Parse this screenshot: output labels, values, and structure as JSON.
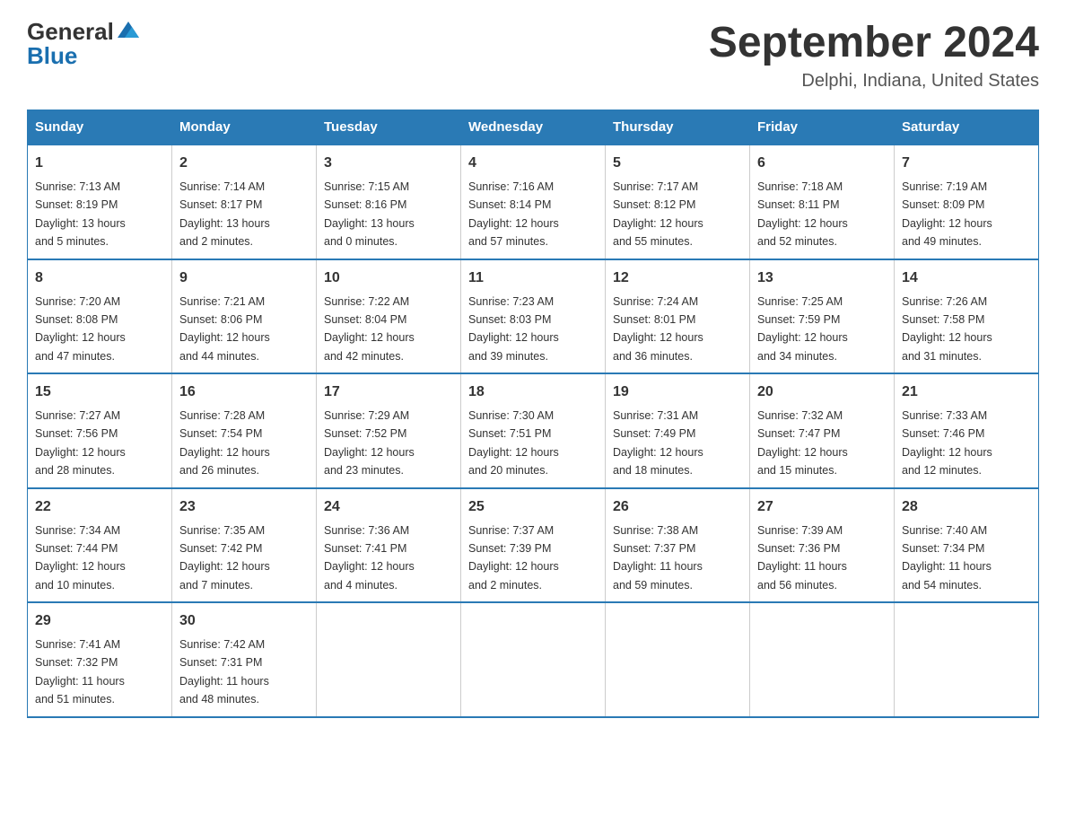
{
  "header": {
    "logo_general": "General",
    "logo_blue": "Blue",
    "title": "September 2024",
    "subtitle": "Delphi, Indiana, United States"
  },
  "weekdays": [
    "Sunday",
    "Monday",
    "Tuesday",
    "Wednesday",
    "Thursday",
    "Friday",
    "Saturday"
  ],
  "weeks": [
    [
      {
        "day": "1",
        "sunrise": "7:13 AM",
        "sunset": "8:19 PM",
        "daylight": "13 hours and 5 minutes."
      },
      {
        "day": "2",
        "sunrise": "7:14 AM",
        "sunset": "8:17 PM",
        "daylight": "13 hours and 2 minutes."
      },
      {
        "day": "3",
        "sunrise": "7:15 AM",
        "sunset": "8:16 PM",
        "daylight": "13 hours and 0 minutes."
      },
      {
        "day": "4",
        "sunrise": "7:16 AM",
        "sunset": "8:14 PM",
        "daylight": "12 hours and 57 minutes."
      },
      {
        "day": "5",
        "sunrise": "7:17 AM",
        "sunset": "8:12 PM",
        "daylight": "12 hours and 55 minutes."
      },
      {
        "day": "6",
        "sunrise": "7:18 AM",
        "sunset": "8:11 PM",
        "daylight": "12 hours and 52 minutes."
      },
      {
        "day": "7",
        "sunrise": "7:19 AM",
        "sunset": "8:09 PM",
        "daylight": "12 hours and 49 minutes."
      }
    ],
    [
      {
        "day": "8",
        "sunrise": "7:20 AM",
        "sunset": "8:08 PM",
        "daylight": "12 hours and 47 minutes."
      },
      {
        "day": "9",
        "sunrise": "7:21 AM",
        "sunset": "8:06 PM",
        "daylight": "12 hours and 44 minutes."
      },
      {
        "day": "10",
        "sunrise": "7:22 AM",
        "sunset": "8:04 PM",
        "daylight": "12 hours and 42 minutes."
      },
      {
        "day": "11",
        "sunrise": "7:23 AM",
        "sunset": "8:03 PM",
        "daylight": "12 hours and 39 minutes."
      },
      {
        "day": "12",
        "sunrise": "7:24 AM",
        "sunset": "8:01 PM",
        "daylight": "12 hours and 36 minutes."
      },
      {
        "day": "13",
        "sunrise": "7:25 AM",
        "sunset": "7:59 PM",
        "daylight": "12 hours and 34 minutes."
      },
      {
        "day": "14",
        "sunrise": "7:26 AM",
        "sunset": "7:58 PM",
        "daylight": "12 hours and 31 minutes."
      }
    ],
    [
      {
        "day": "15",
        "sunrise": "7:27 AM",
        "sunset": "7:56 PM",
        "daylight": "12 hours and 28 minutes."
      },
      {
        "day": "16",
        "sunrise": "7:28 AM",
        "sunset": "7:54 PM",
        "daylight": "12 hours and 26 minutes."
      },
      {
        "day": "17",
        "sunrise": "7:29 AM",
        "sunset": "7:52 PM",
        "daylight": "12 hours and 23 minutes."
      },
      {
        "day": "18",
        "sunrise": "7:30 AM",
        "sunset": "7:51 PM",
        "daylight": "12 hours and 20 minutes."
      },
      {
        "day": "19",
        "sunrise": "7:31 AM",
        "sunset": "7:49 PM",
        "daylight": "12 hours and 18 minutes."
      },
      {
        "day": "20",
        "sunrise": "7:32 AM",
        "sunset": "7:47 PM",
        "daylight": "12 hours and 15 minutes."
      },
      {
        "day": "21",
        "sunrise": "7:33 AM",
        "sunset": "7:46 PM",
        "daylight": "12 hours and 12 minutes."
      }
    ],
    [
      {
        "day": "22",
        "sunrise": "7:34 AM",
        "sunset": "7:44 PM",
        "daylight": "12 hours and 10 minutes."
      },
      {
        "day": "23",
        "sunrise": "7:35 AM",
        "sunset": "7:42 PM",
        "daylight": "12 hours and 7 minutes."
      },
      {
        "day": "24",
        "sunrise": "7:36 AM",
        "sunset": "7:41 PM",
        "daylight": "12 hours and 4 minutes."
      },
      {
        "day": "25",
        "sunrise": "7:37 AM",
        "sunset": "7:39 PM",
        "daylight": "12 hours and 2 minutes."
      },
      {
        "day": "26",
        "sunrise": "7:38 AM",
        "sunset": "7:37 PM",
        "daylight": "11 hours and 59 minutes."
      },
      {
        "day": "27",
        "sunrise": "7:39 AM",
        "sunset": "7:36 PM",
        "daylight": "11 hours and 56 minutes."
      },
      {
        "day": "28",
        "sunrise": "7:40 AM",
        "sunset": "7:34 PM",
        "daylight": "11 hours and 54 minutes."
      }
    ],
    [
      {
        "day": "29",
        "sunrise": "7:41 AM",
        "sunset": "7:32 PM",
        "daylight": "11 hours and 51 minutes."
      },
      {
        "day": "30",
        "sunrise": "7:42 AM",
        "sunset": "7:31 PM",
        "daylight": "11 hours and 48 minutes."
      },
      null,
      null,
      null,
      null,
      null
    ]
  ],
  "labels": {
    "sunrise": "Sunrise:",
    "sunset": "Sunset:",
    "daylight": "Daylight:"
  }
}
